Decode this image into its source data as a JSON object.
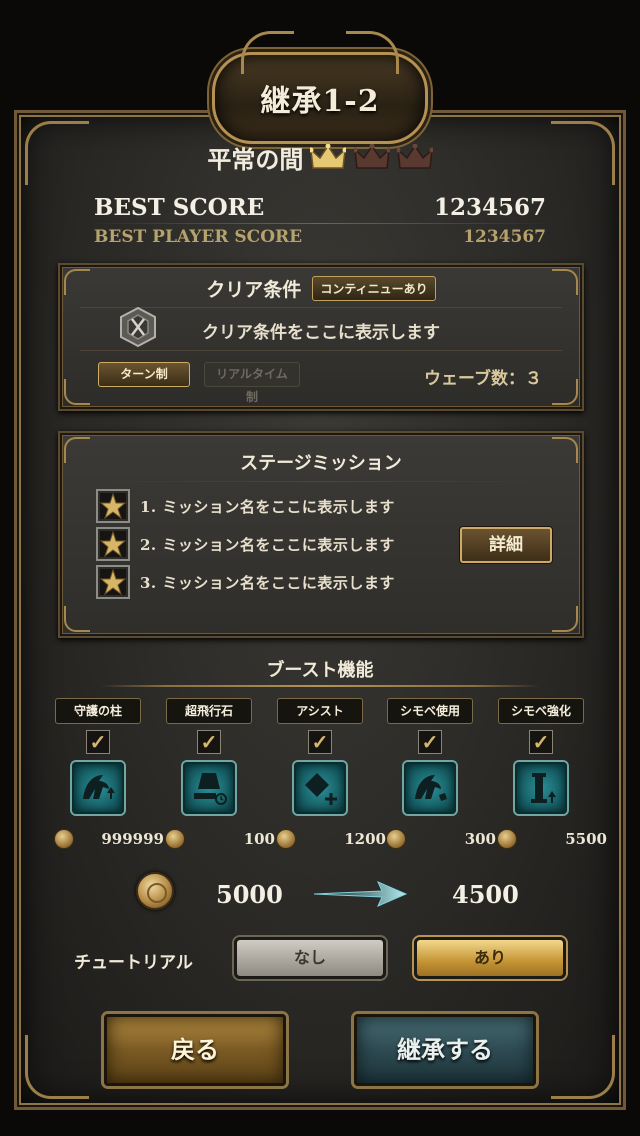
{
  "header": {
    "title": "継承1-2"
  },
  "difficulty": {
    "label": "平常の間",
    "crowns_earned": 1,
    "crowns_total": 3
  },
  "score": {
    "best_label": "BEST SCORE",
    "best_value": "1234567",
    "player_label": "BEST PLAYER SCORE",
    "player_value": "1234567"
  },
  "clear": {
    "title": "クリア条件",
    "continue_badge": "コンティニューあり",
    "description": "クリア条件をここに表示します",
    "mode_turn": "ターン制",
    "mode_realtime": "リアルタイム制",
    "wave_label": "ウェーブ数：３"
  },
  "missions": {
    "title": "ステージミッション",
    "items": [
      "1. ミッション名をここに表示します",
      "2. ミッション名をここに表示します",
      "3. ミッション名をここに表示します"
    ],
    "detail_button": "詳細"
  },
  "boost": {
    "title": "ブースト機能",
    "items": [
      {
        "label": "守護の柱",
        "cost": "999999",
        "checked": true,
        "icon": "guardian-pillar-icon"
      },
      {
        "label": "超飛行石",
        "cost": "100",
        "checked": true,
        "icon": "flight-stone-icon"
      },
      {
        "label": "アシスト",
        "cost": "1200",
        "checked": true,
        "icon": "assist-icon"
      },
      {
        "label": "シモベ使用",
        "cost": "300",
        "checked": true,
        "icon": "servant-use-icon"
      },
      {
        "label": "シモベ強化",
        "cost": "5500",
        "checked": true,
        "icon": "servant-boost-icon"
      }
    ],
    "total_before": "5000",
    "total_after": "4500"
  },
  "tutorial": {
    "label": "チュートリアル",
    "off": "なし",
    "on": "あり",
    "selected": "on"
  },
  "footer": {
    "back_button": "戻る",
    "inherit_button": "継承する"
  },
  "colors": {
    "gold": "#b69154",
    "teal_icon": "#1f7a80",
    "panel_bg": "#2d2c29"
  }
}
